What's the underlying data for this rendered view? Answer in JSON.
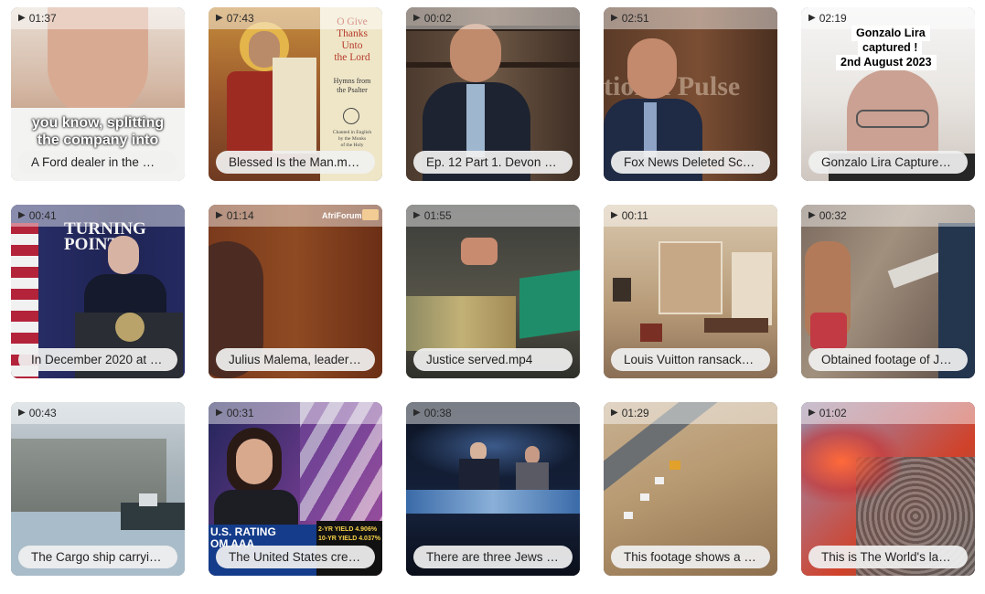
{
  "videos": [
    {
      "duration": "01:37",
      "title": "A Ford dealer in the …",
      "overlay": "you know, splitting\nthe company into"
    },
    {
      "duration": "07:43",
      "title": "Blessed Is the Man.m…",
      "overlay_title": "O Give\nThanks\nUnto\nthe Lord",
      "overlay_sub": "Hymns from\nthe Psalter",
      "overlay_small": "Chanted in English\nby the Monks\nof the Holy"
    },
    {
      "duration": "00:02",
      "title": "Ep. 12 Part 1. Devon …"
    },
    {
      "duration": "02:51",
      "title": "Fox News Deleted Sc…",
      "overlay": "tional Pulse"
    },
    {
      "duration": "02:19",
      "title": "Gonzalo Lira Capture…",
      "overlay_lines": [
        "Gonzalo Lira",
        "captured !",
        "2nd August 2023"
      ]
    },
    {
      "duration": "00:41",
      "title": "In December 2020 at …",
      "overlay": "TURNING\nPOINT"
    },
    {
      "duration": "01:14",
      "title": "Julius Malema, leader …",
      "overlay": "AfriForum"
    },
    {
      "duration": "01:55",
      "title": "Justice served.mp4"
    },
    {
      "duration": "00:11",
      "title": "Louis Vuitton ransack…"
    },
    {
      "duration": "00:32",
      "title": "Obtained footage of J…"
    },
    {
      "duration": "00:43",
      "title": "The Cargo ship carryi…"
    },
    {
      "duration": "00:31",
      "title": "The United States cre…",
      "overlay": "U.S. RATING\nOM AAA",
      "ticker": [
        "2-YR YIELD 4.906%",
        "10-YR YIELD 4.037%"
      ]
    },
    {
      "duration": "00:38",
      "title": "There are three Jews …"
    },
    {
      "duration": "01:29",
      "title": "This footage shows a …"
    },
    {
      "duration": "01:02",
      "title": "This is The World's lar…"
    }
  ],
  "icons": {
    "play": "play-icon"
  }
}
